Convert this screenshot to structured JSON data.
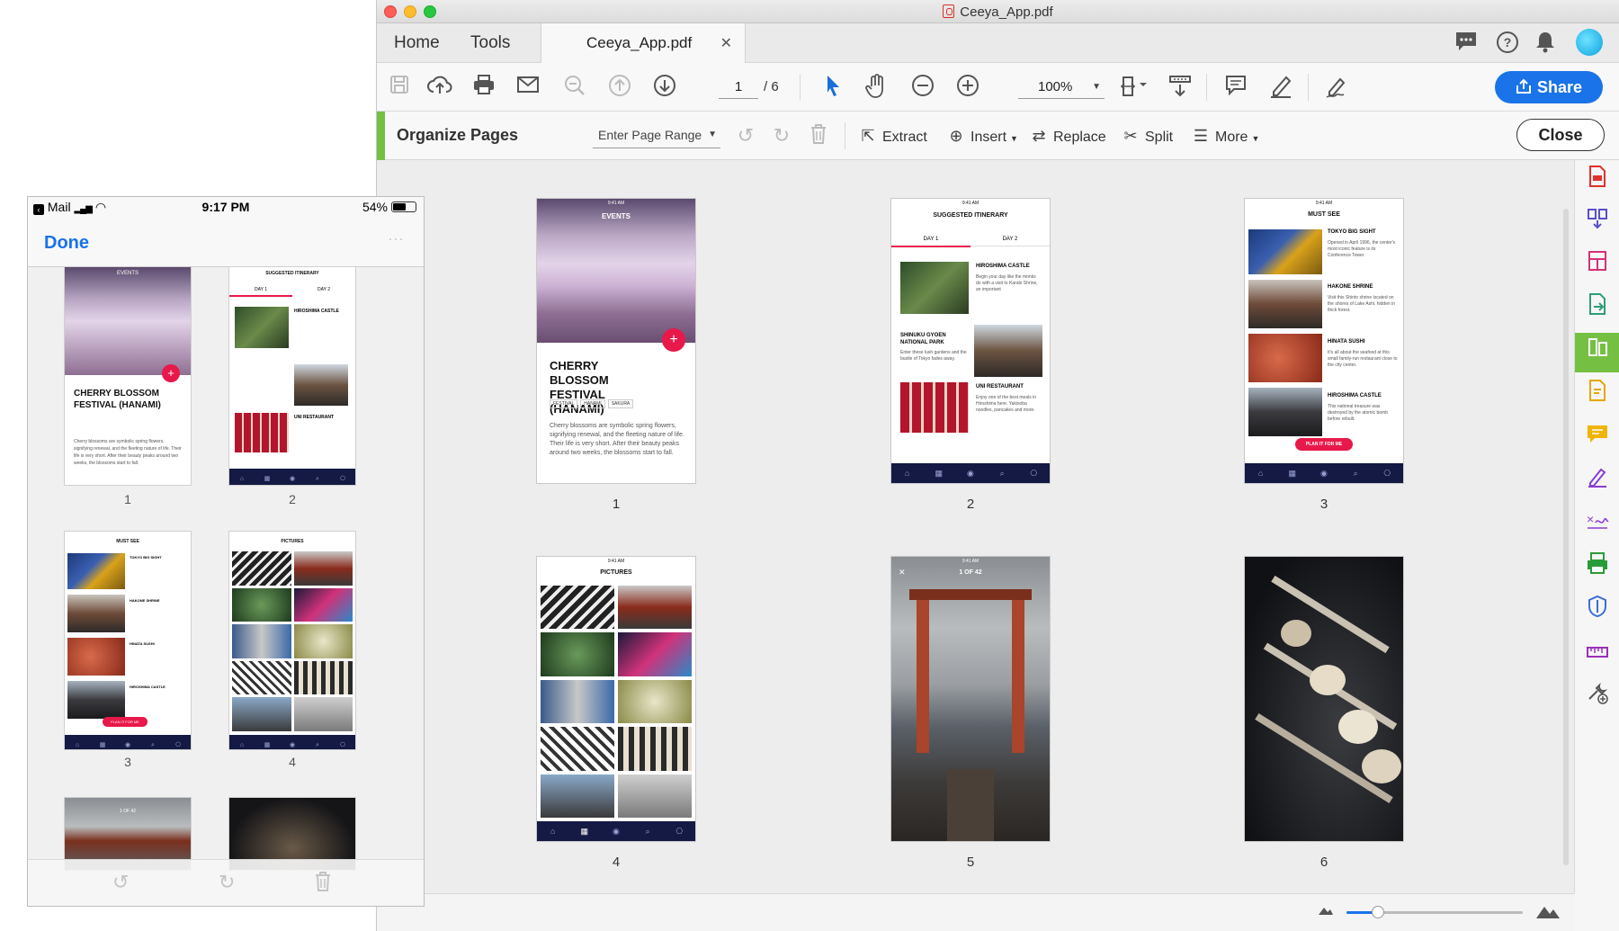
{
  "window": {
    "title": "Ceeya_App.pdf",
    "tabs": {
      "home": "Home",
      "tools": "Tools",
      "document": "Ceeya_App.pdf"
    },
    "header_icons": [
      "chat-icon",
      "help-icon",
      "bell-icon",
      "avatar"
    ]
  },
  "toolbar": {
    "page_current": "1",
    "page_total": "/ 6",
    "zoom": "100%",
    "share_label": "Share",
    "icons": [
      "save-icon",
      "upload-icon",
      "print-icon",
      "email-icon",
      "zoom-out-search-icon",
      "page-up-icon",
      "page-down-icon",
      "select-arrow-icon",
      "hand-icon",
      "zoom-out-icon",
      "zoom-in-icon",
      "fit-page-icon",
      "scroll-mode-icon",
      "comment-icon",
      "highlight-icon",
      "sign-icon"
    ]
  },
  "organize": {
    "title": "Organize Pages",
    "range_placeholder": "Enter Page Range",
    "extract": "Extract",
    "insert": "Insert",
    "replace": "Replace",
    "split": "Split",
    "more": "More",
    "close": "Close"
  },
  "pages": [
    {
      "num": "1",
      "title": "EVENTS",
      "heading": "CHERRY BLOSSOM FESTIVAL (HANAMI)",
      "tags": [
        "FESTIVAL",
        "HANAMI",
        "SAKURA"
      ],
      "body": "Cherry blossoms are symbolic spring flowers, signifying renewal, and the fleeting nature of life. Their life is very short. After their beauty peaks around two weeks, the blossoms start to fall."
    },
    {
      "num": "2",
      "title": "SUGGESTED ITINERARY",
      "tabs": [
        "DAY 1",
        "DAY 2"
      ],
      "items": [
        {
          "name": "HIROSHIMA CASTLE",
          "text": "Begin your day like the monks do with a visit to Kando Shrine, an important"
        },
        {
          "name": "SHINUKU GYOEN NATIONAL PARK",
          "text": "Enter these lush gardens and the bustle of Tokyo fades away."
        },
        {
          "name": "UNI RESTAURANT",
          "text": "Enjoy one of the best meals in Hiroshima here. Yakisoba noodles, pancakes and more."
        }
      ]
    },
    {
      "num": "3",
      "title": "MUST SEE",
      "items": [
        {
          "name": "TOKYO BIG SIGHT",
          "text": "Opened in April 1996, the center's most iconic feature is its Conference Tower."
        },
        {
          "name": "HAKONE SHRINE",
          "text": "Visit this Shinto shrine located on the shores of Lake Ashi, hidden in thick forest."
        },
        {
          "name": "HINATA SUSHI",
          "text": "It's all about the seafood at this small family-run restaurant close to the city center."
        },
        {
          "name": "HIROSHIMA CASTLE",
          "text": "This national treasure was destroyed by the atomic bomb before rebuilt."
        }
      ],
      "cta": "PLAN IT FOR ME"
    },
    {
      "num": "4",
      "title": "PICTURES"
    },
    {
      "num": "5",
      "title": "1 OF 42"
    },
    {
      "num": "6"
    }
  ],
  "status_time": "9:41 AM",
  "ipad": {
    "carrier": "Mail",
    "time": "9:17 PM",
    "battery": "54%",
    "done": "Done",
    "page_numbers": [
      "1",
      "2",
      "3",
      "4"
    ],
    "tools": [
      "rotate-left-icon",
      "rotate-right-icon",
      "trash-icon"
    ]
  },
  "colors": {
    "accent_blue": "#1a73e8",
    "organize_green": "#75c043",
    "app_red": "#e8194a",
    "nav_navy": "#141a44"
  },
  "zoom_slider_fraction": 0.18
}
